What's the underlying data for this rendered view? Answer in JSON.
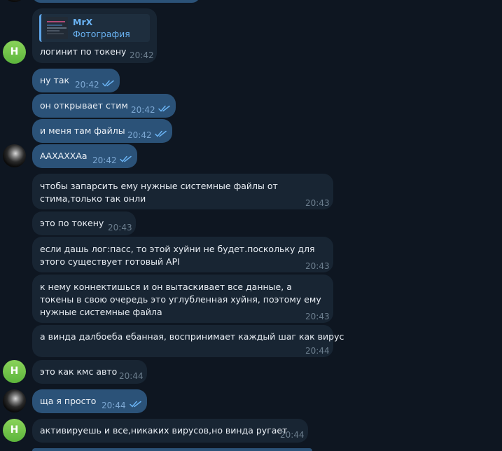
{
  "colors": {
    "background": "#0e1621",
    "incoming_bubble": "#182533",
    "outgoing_bubble": "#2b5278",
    "read_ticks": "#6ab3f3",
    "avatar_green": "#6cc249"
  },
  "avatar_letter": "Н",
  "reply_preview": {
    "author": "MrX",
    "caption": "Фотография"
  },
  "messages": [
    {
      "text": "логинит по токену",
      "time": "20:42"
    },
    {
      "text": "ну так",
      "time": "20:42",
      "status": "read"
    },
    {
      "text": "он открывает стим",
      "time": "20:42",
      "status": "read"
    },
    {
      "text": "и меня там файлы",
      "time": "20:42",
      "status": "read"
    },
    {
      "text": "ААХАХХАа",
      "time": "20:42",
      "status": "read"
    },
    {
      "text": "чтобы запарсить ему нужные системные файлы от стима,только так онли",
      "time": "20:43"
    },
    {
      "text": "это по токену",
      "time": "20:43"
    },
    {
      "text": "если дашь лог:пасс, то этой хуйни не будет.поскольку для этого существует готовый API",
      "time": "20:43"
    },
    {
      "text": "к нему коннектишься и он вытаскивает все данные, а токены в свою очередь это углубленная хуйня, поэтому ему нужные системные файла",
      "time": "20:43"
    },
    {
      "text": "а винда далбоеба ебанная, воспринимает каждый шаг как вирус",
      "time": "20:44"
    },
    {
      "text": "это как кмс авто",
      "time": "20:44"
    },
    {
      "text": "ща я просто",
      "time": "20:44",
      "status": "read"
    },
    {
      "text": "активируешь и все,никаких вирусов,но винда ругает",
      "time": "20:44"
    }
  ]
}
